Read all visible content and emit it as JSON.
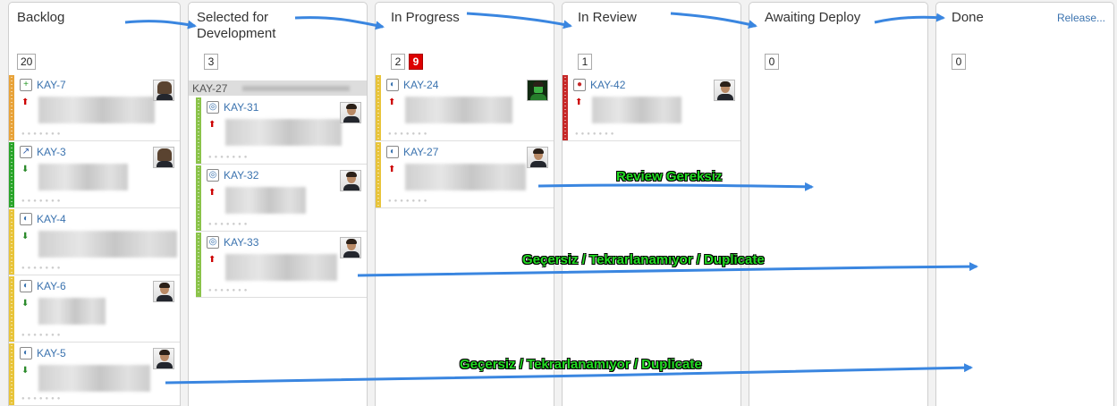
{
  "columns": [
    {
      "title": "Backlog",
      "count": "20"
    },
    {
      "title": "Selected for\nDevelopment",
      "count": "3"
    },
    {
      "title": "In Progress",
      "count": "2",
      "max": "9"
    },
    {
      "title": "In Review",
      "count": "1"
    },
    {
      "title": "Awaiting Deploy",
      "count": "0"
    },
    {
      "title": "Done",
      "count": "0",
      "release": "Release..."
    }
  ],
  "swimlane": {
    "key": "KAY-27"
  },
  "cards": {
    "kay7": {
      "key": "KAY-7",
      "stripe": "#e8a33a",
      "icon": "new-feature-icon",
      "priority": "up",
      "avatar": "long"
    },
    "kay3": {
      "key": "KAY-3",
      "stripe": "#2aa52a",
      "icon": "improvement-icon",
      "priority": "down",
      "avatar": "long"
    },
    "kay4": {
      "key": "KAY-4",
      "stripe": "#e8c43a",
      "icon": "idea-icon",
      "priority": "down",
      "avatar": "none"
    },
    "kay6": {
      "key": "KAY-6",
      "stripe": "#e8c43a",
      "icon": "idea-icon",
      "priority": "down",
      "avatar": "suit"
    },
    "kay5": {
      "key": "KAY-5",
      "stripe": "#e8c43a",
      "icon": "idea-icon",
      "priority": "down",
      "avatar": "suit"
    },
    "kay31": {
      "key": "KAY-31",
      "stripe": "#8bc34a",
      "icon": "subtask-icon",
      "priority": "up",
      "avatar": "suit"
    },
    "kay32": {
      "key": "KAY-32",
      "stripe": "#8bc34a",
      "icon": "subtask-icon",
      "priority": "up",
      "avatar": "suit"
    },
    "kay33": {
      "key": "KAY-33",
      "stripe": "#8bc34a",
      "icon": "subtask-icon",
      "priority": "up",
      "avatar": "suit"
    },
    "kay24": {
      "key": "KAY-24",
      "stripe": "#e8c43a",
      "icon": "idea-icon",
      "priority": "up",
      "avatar": "green"
    },
    "kay27": {
      "key": "KAY-27",
      "stripe": "#e8c43a",
      "icon": "idea-icon",
      "priority": "up",
      "avatar": "suit"
    },
    "kay42": {
      "key": "KAY-42",
      "stripe": "#c62828",
      "icon": "bug-icon",
      "priority": "up",
      "avatar": "suit"
    }
  },
  "annotations": {
    "review": "Review Gereksiz",
    "dup1": "Geçersiz / Tekrarlanamıyor / Duplicate",
    "dup2": "Geçersiz / Tekrarlanamıyor / Duplicate"
  },
  "colors": {
    "arrow": "#3a86e0",
    "annotation": "#22dd22",
    "link": "#3b73af"
  }
}
